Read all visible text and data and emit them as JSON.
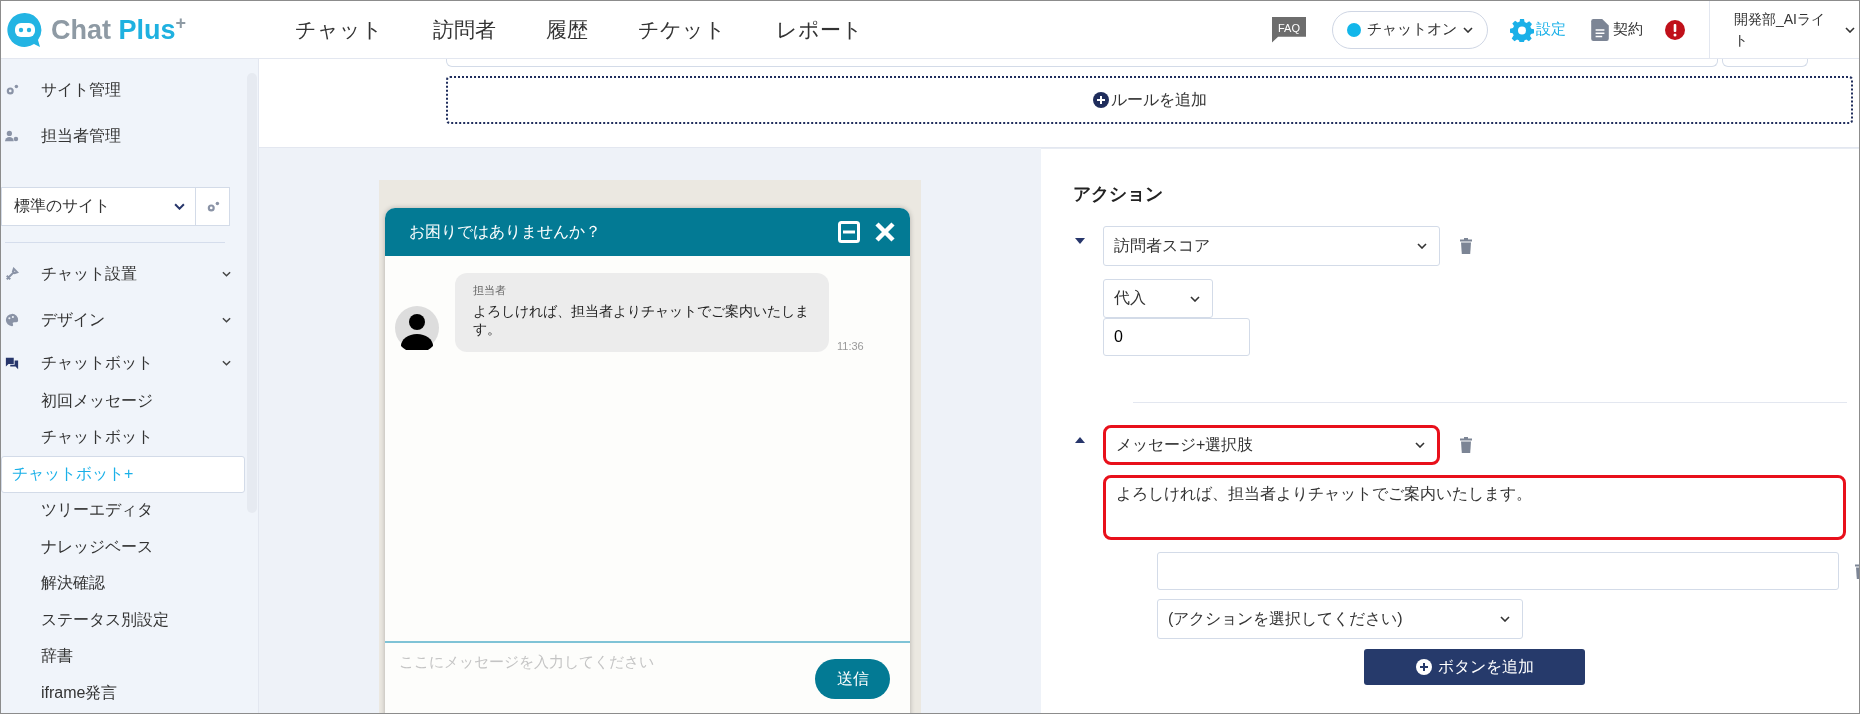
{
  "header": {
    "logo": {
      "name": "Chat",
      "accent": "Plus",
      "mark": "+"
    },
    "nav": [
      {
        "label": "チャット"
      },
      {
        "label": "訪問者"
      },
      {
        "label": "履歴"
      },
      {
        "label": "チケット"
      },
      {
        "label": "レポート"
      }
    ],
    "faq": "FAQ",
    "status": {
      "label": "チャットオン",
      "online": true
    },
    "settings": "設定",
    "contract": "契約",
    "user": "開発部_AIライト"
  },
  "sidebar": {
    "admin_items": [
      {
        "label": "サイト管理",
        "kind": "gears"
      },
      {
        "label": "担当者管理",
        "kind": "user"
      }
    ],
    "site_select": "標準のサイト",
    "sections": [
      {
        "label": "チャット設置",
        "kind": "tools"
      },
      {
        "label": "デザイン",
        "kind": "palette"
      },
      {
        "label": "チャットボット",
        "kind": "chat",
        "children": [
          {
            "label": "初回メッセージ",
            "selected": false
          },
          {
            "label": "チャットボット",
            "selected": false
          },
          {
            "label": "チャットボット+",
            "selected": true
          },
          {
            "label": "ツリーエディタ",
            "selected": false
          },
          {
            "label": "ナレッジベース",
            "selected": false
          },
          {
            "label": "解決確認",
            "selected": false
          },
          {
            "label": "ステータス別設定",
            "selected": false
          },
          {
            "label": "辞書",
            "selected": false
          },
          {
            "label": "iframe発言",
            "selected": false
          }
        ]
      }
    ]
  },
  "rule_editor": {
    "add_rule": "ルールを追加"
  },
  "preview": {
    "title": "お困りではありませんか？",
    "messages": [
      {
        "sender": "担当者",
        "text": "よろしければ、担当者よりチャットでご案内いたします。",
        "time": "11:36"
      }
    ],
    "input": {
      "placeholder": "ここにメッセージを入力してください"
    },
    "send": "送信"
  },
  "actions": {
    "title": "アクション",
    "items": [
      {
        "kind": "score",
        "expanded": true,
        "type": "訪問者スコア",
        "highlighted": false,
        "operator": "代入",
        "value": "0"
      },
      {
        "kind": "message",
        "expanded": false,
        "type": "メッセージ+選択肢",
        "highlighted": true,
        "message": "よろしければ、担当者よりチャットでご案内いたします。",
        "message_highlighted": true,
        "choices": [
          {
            "action": "(アクションを選択してください)"
          }
        ],
        "add_button": "ボタンを追加"
      }
    ]
  }
}
